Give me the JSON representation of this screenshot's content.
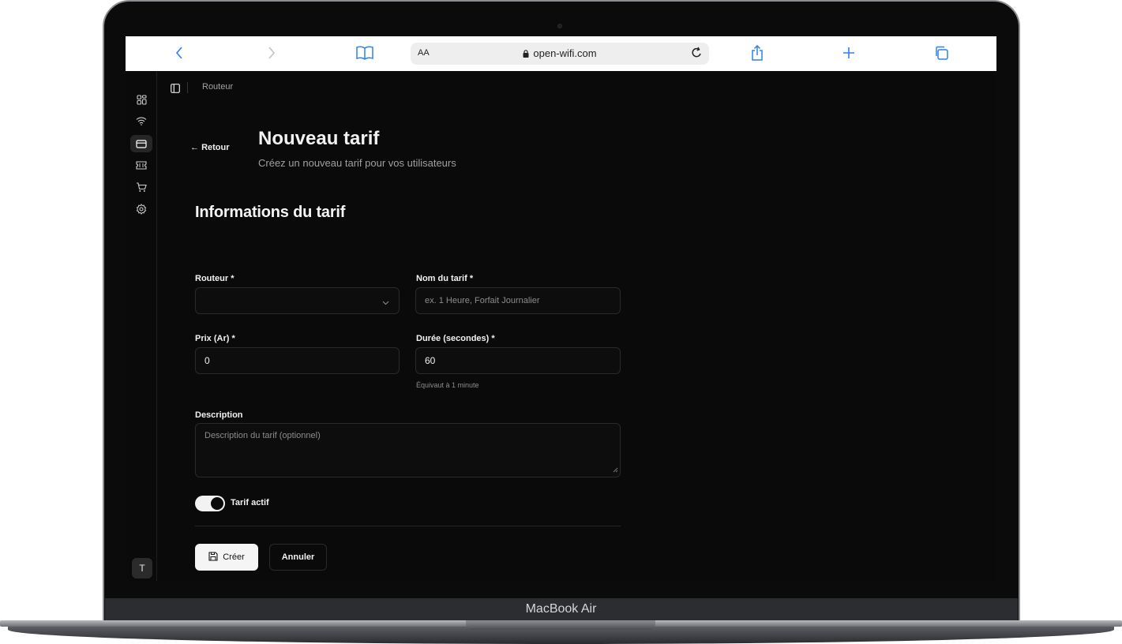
{
  "browser": {
    "aa_label": "AA",
    "url": "open-wifi.com",
    "icons": [
      "back-icon",
      "forward-icon",
      "bookmarks-icon",
      "lock-icon",
      "reload-icon",
      "share-icon",
      "new-tab-icon",
      "tabs-icon"
    ]
  },
  "sidebar": {
    "icons": [
      "dashboard-icon",
      "wifi-icon",
      "card-icon",
      "ticket-icon",
      "cart-icon",
      "settings-icon"
    ],
    "active": "card-icon",
    "avatar": "T"
  },
  "breadcrumb": {
    "label": "Routeur"
  },
  "header": {
    "back_label": "Retour",
    "title": "Nouveau tarif",
    "subtitle": "Créez un nouveau tarif pour vos utilisateurs"
  },
  "form": {
    "section_title": "Informations du tarif",
    "router": {
      "label": "Routeur *",
      "value": ""
    },
    "name": {
      "label": "Nom du tarif *",
      "placeholder": "ex. 1 Heure, Forfait Journalier"
    },
    "price": {
      "label": "Prix (Ar) *",
      "value": "0"
    },
    "duration": {
      "label": "Durée (secondes) *",
      "value": "60",
      "hint": "Équivaut à 1 minute"
    },
    "description": {
      "label": "Description",
      "placeholder": "Description du tarif (optionnel)"
    },
    "active": {
      "label": "Tarif actif",
      "checked": true
    }
  },
  "actions": {
    "create_label": "Créer",
    "cancel_label": "Annuler"
  },
  "device": {
    "brand": "MacBook Air"
  }
}
